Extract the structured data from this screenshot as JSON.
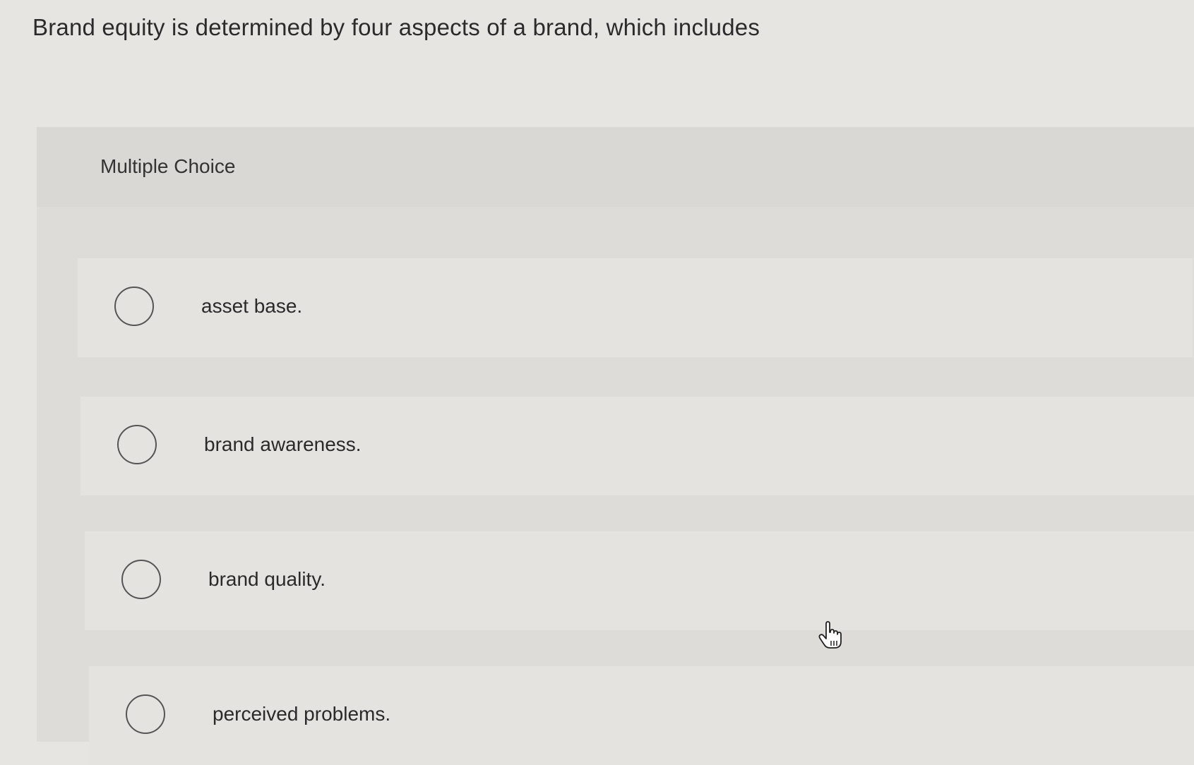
{
  "question": {
    "text": "Brand equity is determined by four aspects of a brand, which includes"
  },
  "section": {
    "label": "Multiple Choice"
  },
  "choices": [
    {
      "label": "asset base.",
      "selected": false
    },
    {
      "label": "brand awareness.",
      "selected": false
    },
    {
      "label": "brand quality.",
      "selected": false
    },
    {
      "label": "perceived problems.",
      "selected": false
    }
  ],
  "cursor": {
    "icon": "hand-pointer-icon"
  }
}
